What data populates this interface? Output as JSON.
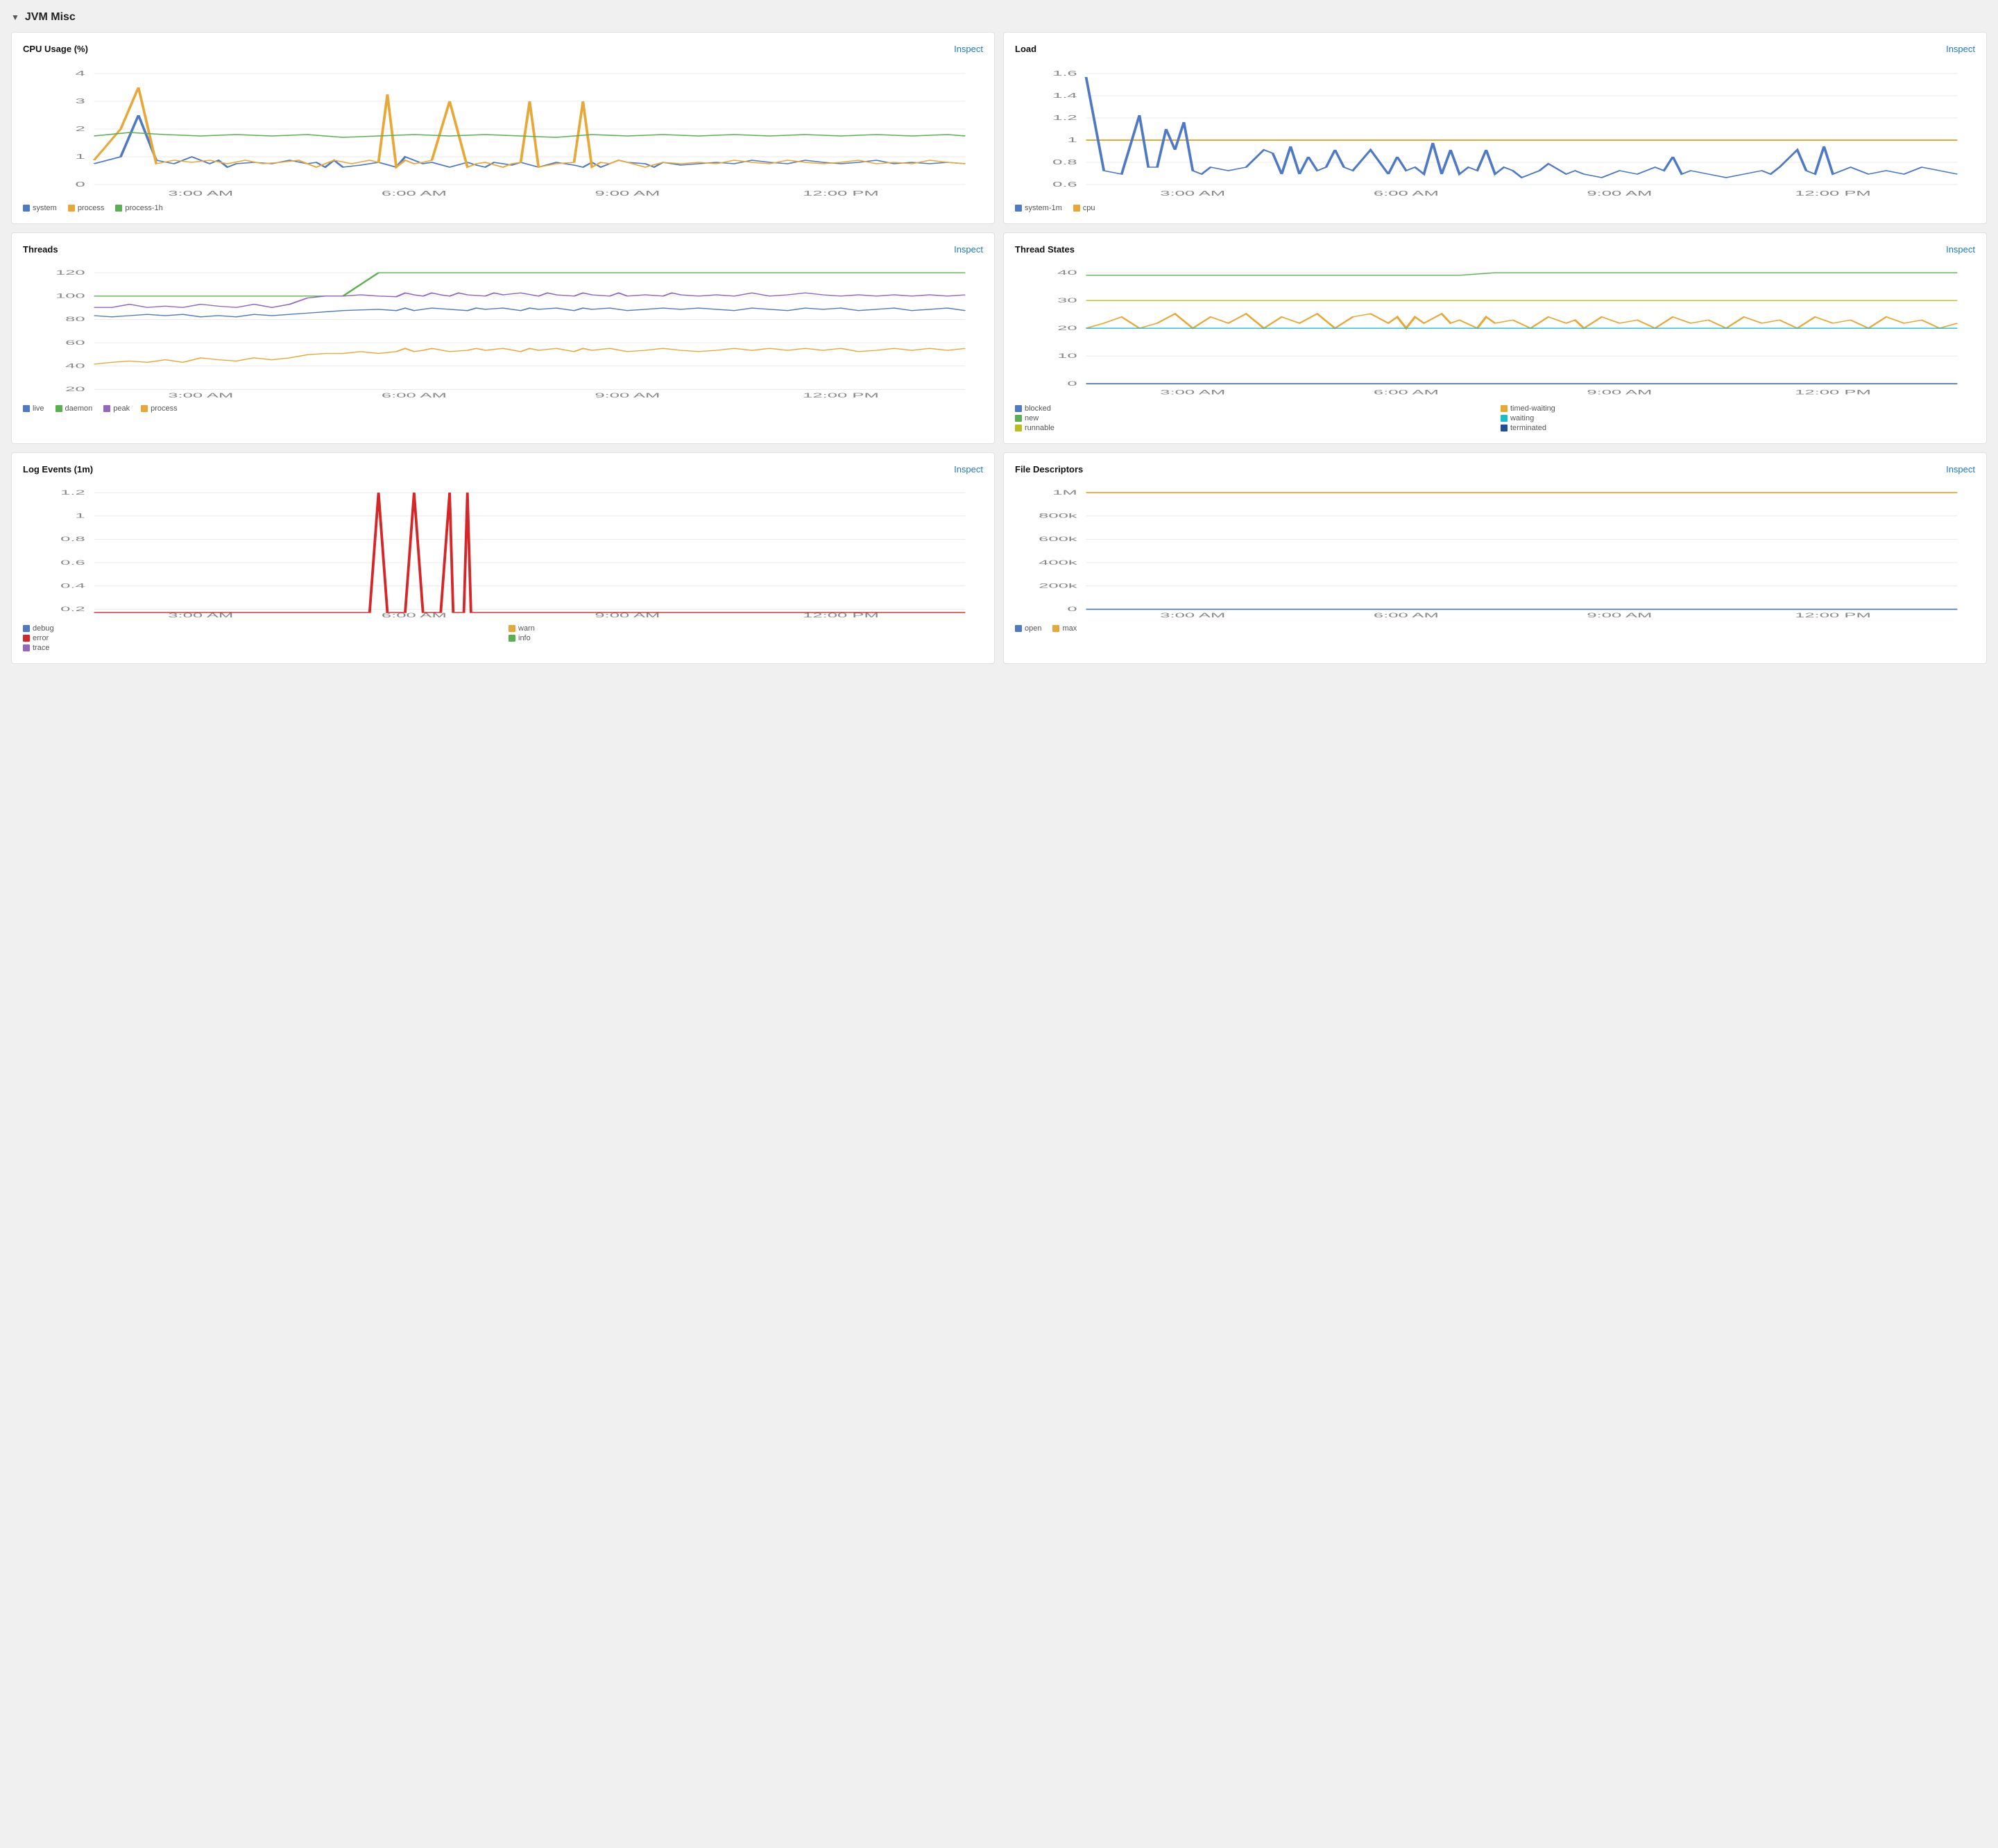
{
  "section": {
    "title": "JVM Misc"
  },
  "cards": [
    {
      "id": "cpu-usage",
      "title": "CPU Usage (%)",
      "inspect_label": "Inspect",
      "legend": [
        {
          "label": "system",
          "color": "#4e79c4"
        },
        {
          "label": "process",
          "color": "#e8a838"
        },
        {
          "label": "process-1h",
          "color": "#5ab050"
        }
      ]
    },
    {
      "id": "load",
      "title": "Load",
      "inspect_label": "Inspect",
      "legend": [
        {
          "label": "system-1m",
          "color": "#4e79c4"
        },
        {
          "label": "cpu",
          "color": "#e8a838"
        }
      ]
    },
    {
      "id": "threads",
      "title": "Threads",
      "inspect_label": "Inspect",
      "legend": [
        {
          "label": "live",
          "color": "#4e79c4"
        },
        {
          "label": "daemon",
          "color": "#5ab050"
        },
        {
          "label": "peak",
          "color": "#9467bd"
        },
        {
          "label": "process",
          "color": "#e8a838"
        }
      ]
    },
    {
      "id": "thread-states",
      "title": "Thread States",
      "inspect_label": "Inspect",
      "legend": [
        {
          "label": "blocked",
          "color": "#4e79c4"
        },
        {
          "label": "timed-waiting",
          "color": "#e8a838"
        },
        {
          "label": "new",
          "color": "#5ab050"
        },
        {
          "label": "waiting",
          "color": "#17becf"
        },
        {
          "label": "runnable",
          "color": "#bcbd22"
        },
        {
          "label": "terminated",
          "color": "#7f7f7f"
        }
      ]
    },
    {
      "id": "log-events",
      "title": "Log Events (1m)",
      "inspect_label": "Inspect",
      "legend": [
        {
          "label": "debug",
          "color": "#4e79c4"
        },
        {
          "label": "warn",
          "color": "#e8a838"
        },
        {
          "label": "error",
          "color": "#d62728"
        },
        {
          "label": "info",
          "color": "#5ab050"
        },
        {
          "label": "trace",
          "color": "#9467bd"
        }
      ]
    },
    {
      "id": "file-descriptors",
      "title": "File Descriptors",
      "inspect_label": "Inspect",
      "legend": [
        {
          "label": "open",
          "color": "#4e79c4"
        },
        {
          "label": "max",
          "color": "#e8a838"
        }
      ]
    }
  ]
}
